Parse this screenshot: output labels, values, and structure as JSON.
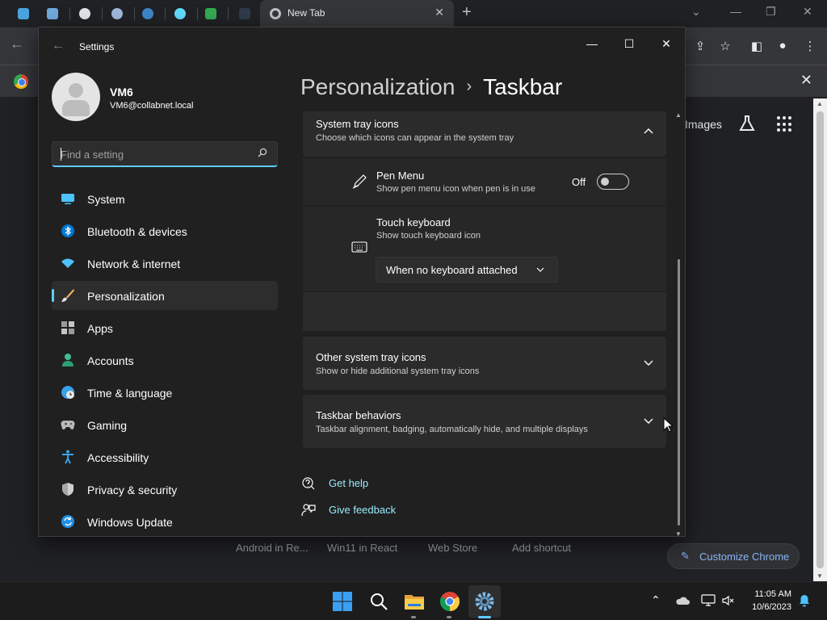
{
  "browser": {
    "tab_title": "New Tab",
    "google_images": "Images",
    "shortcuts": [
      "Android in Re...",
      "Win11 in React",
      "Web Store",
      "Add shortcut"
    ],
    "customize_label": "Customize Chrome"
  },
  "settings": {
    "window_title": "Settings",
    "profile": {
      "name": "VM6",
      "email": "VM6@collabnet.local"
    },
    "search": {
      "placeholder": "Find a setting"
    },
    "nav": [
      {
        "label": "System",
        "icon": "monitor-icon"
      },
      {
        "label": "Bluetooth & devices",
        "icon": "bluetooth-icon"
      },
      {
        "label": "Network & internet",
        "icon": "wifi-icon"
      },
      {
        "label": "Personalization",
        "icon": "paintbrush-icon",
        "selected": true
      },
      {
        "label": "Apps",
        "icon": "apps-icon"
      },
      {
        "label": "Accounts",
        "icon": "person-icon"
      },
      {
        "label": "Time & language",
        "icon": "globe-clock-icon"
      },
      {
        "label": "Gaming",
        "icon": "gamepad-icon"
      },
      {
        "label": "Accessibility",
        "icon": "accessibility-icon"
      },
      {
        "label": "Privacy & security",
        "icon": "shield-icon"
      },
      {
        "label": "Windows Update",
        "icon": "update-icon"
      }
    ],
    "breadcrumb": {
      "parent": "Personalization",
      "current": "Taskbar"
    },
    "system_tray": {
      "title": "System tray icons",
      "subtitle": "Choose which icons can appear in the system tray",
      "pen_menu": {
        "title": "Pen Menu",
        "subtitle": "Show pen menu icon when pen is in use",
        "state_label": "Off"
      },
      "touch_keyboard": {
        "title": "Touch keyboard",
        "subtitle": "Show touch keyboard icon",
        "selected_option": "When no keyboard attached"
      }
    },
    "other_tray": {
      "title": "Other system tray icons",
      "subtitle": "Show or hide additional system tray icons"
    },
    "behaviors": {
      "title": "Taskbar behaviors",
      "subtitle": "Taskbar alignment, badging, automatically hide, and multiple displays"
    },
    "help": {
      "get_help": "Get help",
      "give_feedback": "Give feedback"
    }
  },
  "taskbar": {
    "time": "11:05 AM",
    "date": "10/6/2023"
  },
  "colors": {
    "accent": "#60cdff",
    "link": "#99ebff",
    "background": "#202020",
    "card": "#2b2b2b"
  }
}
